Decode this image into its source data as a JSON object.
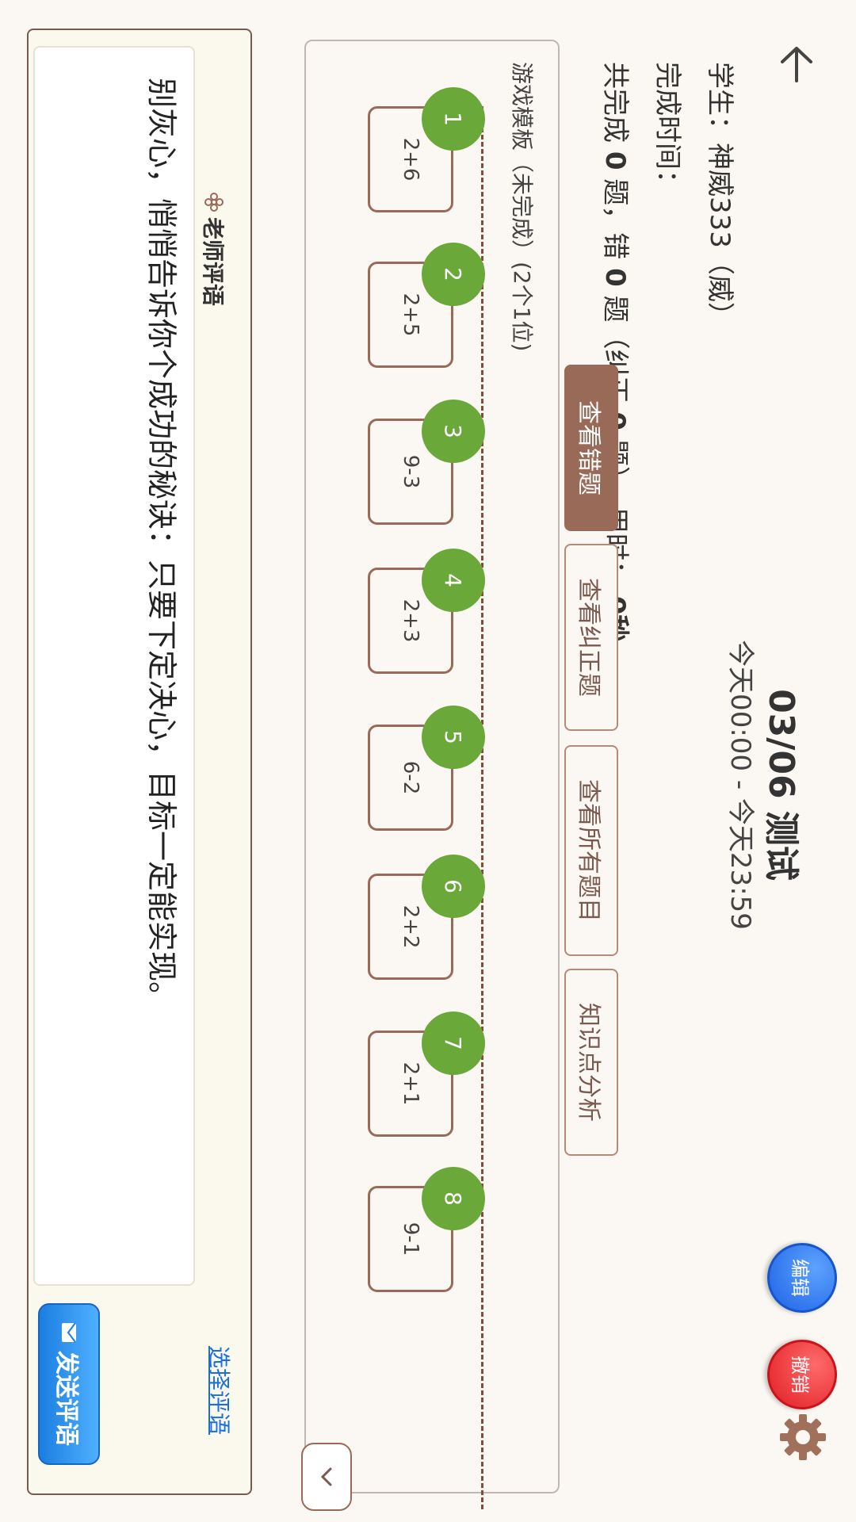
{
  "header": {
    "title": "03/06 测试",
    "time_range": "今天00:00 - 今天23:59",
    "edit_label": "编辑",
    "undo_label": "撤销"
  },
  "info": {
    "student": "学生：神威333（威）",
    "finish_time": "完成时间：",
    "summary_prefix": "共完成",
    "done_count": "0",
    "summary_mid1": "题，错",
    "wrong_count": "0",
    "summary_mid2": "题（纠正",
    "corrected_count": "0",
    "summary_mid3": "题），用时：",
    "time_used": "0秒"
  },
  "tabs": [
    {
      "label": "查看错题",
      "active": true
    },
    {
      "label": "查看纠正题",
      "active": false
    },
    {
      "label": "查看所有题目",
      "active": false
    },
    {
      "label": "知识点分析",
      "active": false
    }
  ],
  "game": {
    "title": "游戏模板（未完成）(2个1位)",
    "questions": [
      {
        "num": "1",
        "expr": "2+6"
      },
      {
        "num": "2",
        "expr": "2+5"
      },
      {
        "num": "3",
        "expr": "9-3"
      },
      {
        "num": "4",
        "expr": "2+3"
      },
      {
        "num": "5",
        "expr": "6-2"
      },
      {
        "num": "6",
        "expr": "2+2"
      },
      {
        "num": "7",
        "expr": "2+1"
      },
      {
        "num": "8",
        "expr": "9-1"
      }
    ]
  },
  "comment": {
    "heading": "老师评语",
    "text": "别灰心，悄悄告诉你个成功的秘诀：只要下定决心，目标一定能实现。",
    "choose_label": "选择评语",
    "send_label": "发送评语"
  },
  "colors": {
    "accent_brown": "#9a6a58",
    "badge_green": "#6aa83a",
    "edit_blue": "#1d62e6",
    "undo_red": "#e01e25",
    "link_blue": "#1a6fe0"
  }
}
